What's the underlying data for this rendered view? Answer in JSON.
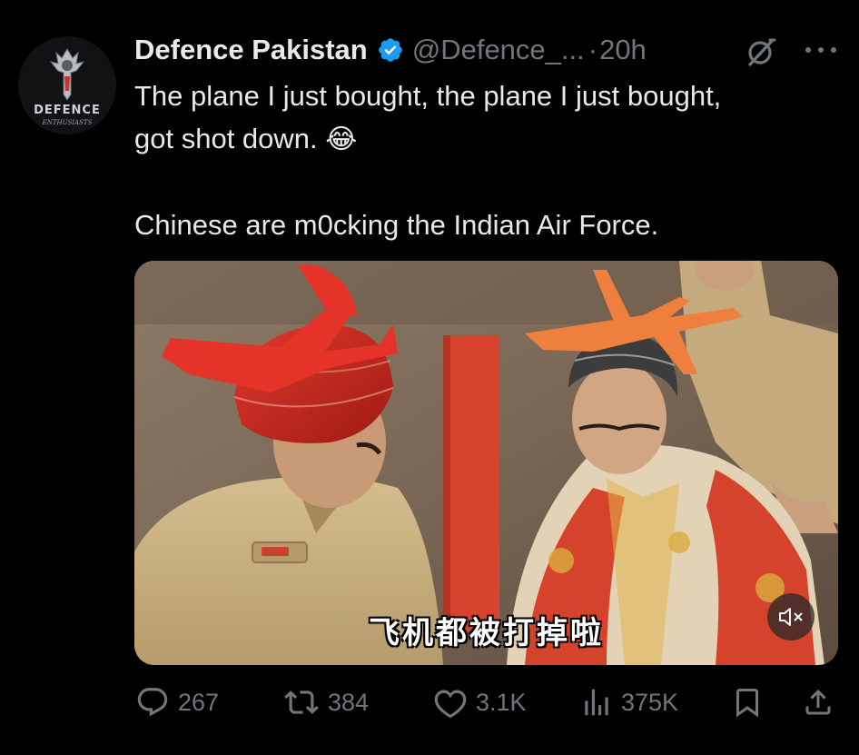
{
  "author": {
    "display_name": "Defence Pakistan",
    "handle": "@Defence_...",
    "separator": "·",
    "time": "20h",
    "verified": true,
    "avatar_text": "DEFENCE",
    "avatar_subtext": "ENTHUSIASTS"
  },
  "tweet": {
    "line1": "The plane I just bought, the plane I just bought,",
    "line2": "got shot down.",
    "emoji": "😂",
    "line3": "Chinese are m0cking the Indian Air Force."
  },
  "media": {
    "subtitle": "飞机都被打掉啦"
  },
  "actions": {
    "replies": "267",
    "reposts": "384",
    "likes": "3.1K",
    "views": "375K"
  },
  "icons": {
    "verified": "verified-badge-icon",
    "grok": "grok-icon",
    "more": "more-icon",
    "mute": "volume-muted-icon",
    "reply": "reply-icon",
    "repost": "repost-icon",
    "like": "heart-icon",
    "views": "views-icon",
    "bookmark": "bookmark-icon",
    "share": "share-icon"
  },
  "colors": {
    "background": "#000000",
    "text_primary": "#e7e9ea",
    "text_secondary": "#71767b",
    "verified_blue": "#1d9bf0"
  }
}
